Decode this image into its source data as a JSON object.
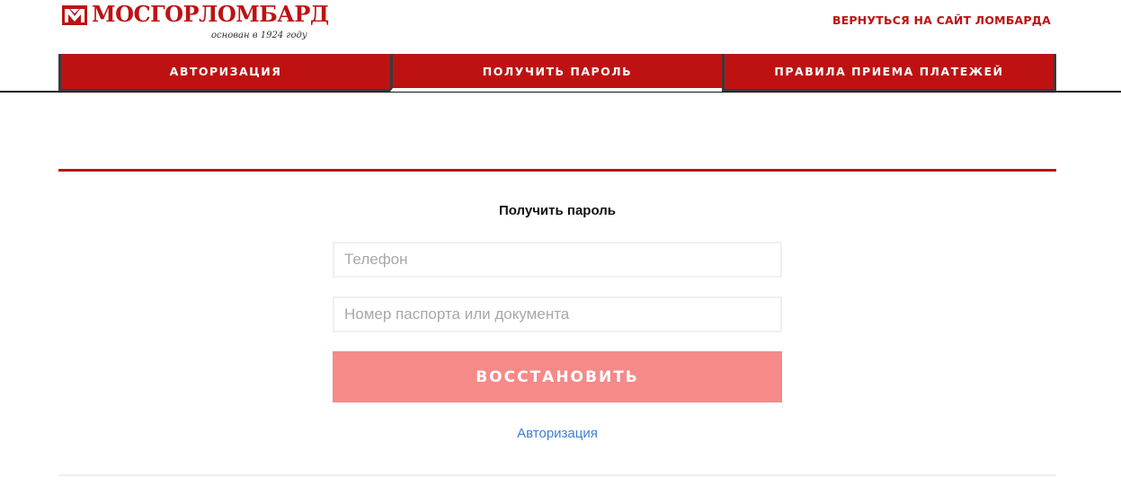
{
  "header": {
    "logo_text": "МОСГОРЛОМБАРД",
    "logo_subtitle": "основан в 1924 году",
    "back_link": "ВЕРНУТЬСЯ НА САЙТ ЛОМБАРДА"
  },
  "nav": {
    "tabs": [
      {
        "label": "АВТОРИЗАЦИЯ",
        "active": false
      },
      {
        "label": "ПОЛУЧИТЬ ПАРОЛЬ",
        "active": true
      },
      {
        "label": "ПРАВИЛА ПРИЕМА ПЛАТЕЖЕЙ",
        "active": false
      }
    ]
  },
  "form": {
    "title": "Получить пароль",
    "phone": {
      "value": "",
      "placeholder": "Телефон"
    },
    "passport": {
      "value": "",
      "placeholder": "Номер паспорта или документа"
    },
    "submit_label": "ВОССТАНОВИТЬ",
    "auth_link": "Авторизация"
  },
  "colors": {
    "brand_red": "#be1212",
    "button_pink": "#f58a88",
    "link_blue": "#3b7fd4"
  }
}
